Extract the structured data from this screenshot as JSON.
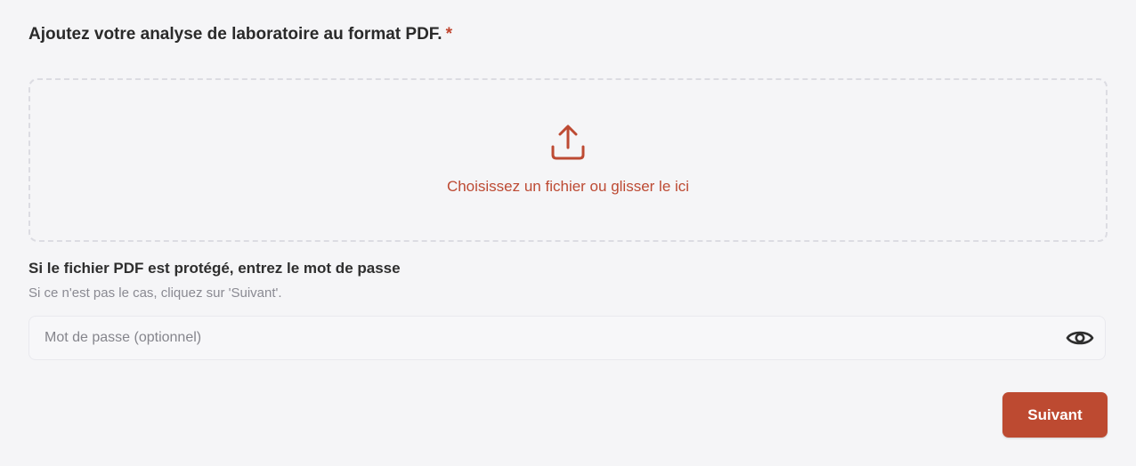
{
  "upload": {
    "title": "Ajoutez votre analyse de laboratoire au format PDF.",
    "required_mark": "*",
    "dropzone_text": "Choisissez un fichier ou glisser le ici",
    "icon": "upload-icon"
  },
  "password": {
    "heading": "Si le fichier PDF est protégé, entrez le mot de passe",
    "subtext": "Si ce n'est pas le cas, cliquez sur 'Suivant'.",
    "placeholder": "Mot de passe (optionnel)",
    "value": "",
    "toggle_icon": "eye-icon"
  },
  "actions": {
    "next_label": "Suivant"
  },
  "colors": {
    "accent": "#bd4a31",
    "background": "#f5f5f7",
    "border": "#dcdce2"
  }
}
